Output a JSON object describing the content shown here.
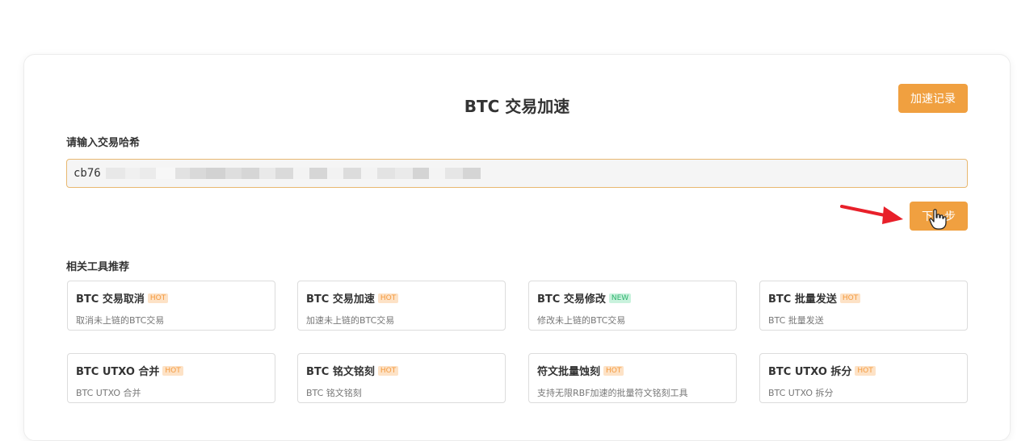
{
  "title": "BTC 交易加速",
  "record_button": "加速记录",
  "hash_label": "请输入交易哈希",
  "hash_value": "cb76",
  "next_button": "下一步",
  "tools_label": "相关工具推荐",
  "tools": [
    {
      "name": "BTC 交易取消",
      "tag": "HOT",
      "desc": "取消未上链的BTC交易"
    },
    {
      "name": "BTC 交易加速",
      "tag": "HOT",
      "desc": "加速未上链的BTC交易"
    },
    {
      "name": "BTC 交易修改",
      "tag": "NEW",
      "desc": "修改未上链的BTC交易"
    },
    {
      "name": "BTC 批量发送",
      "tag": "HOT",
      "desc": "BTC 批量发送"
    },
    {
      "name": "BTC UTXO 合并",
      "tag": "HOT",
      "desc": "BTC UTXO 合并"
    },
    {
      "name": "BTC 铭文铭刻",
      "tag": "HOT",
      "desc": "BTC 铭文铭刻"
    },
    {
      "name": "符文批量蚀刻",
      "tag": "HOT",
      "desc": "支持无限RBF加速的批量符文铭刻工具"
    },
    {
      "name": "BTC UTXO 拆分",
      "tag": "HOT",
      "desc": "BTC UTXO 拆分"
    }
  ],
  "colors": {
    "accent": "#f0a040",
    "hot_bg": "#fde2c6",
    "hot_text": "#f49a3f",
    "new_bg": "#c9f2dd",
    "new_text": "#2fb36e",
    "arrow": "#e8202a"
  }
}
